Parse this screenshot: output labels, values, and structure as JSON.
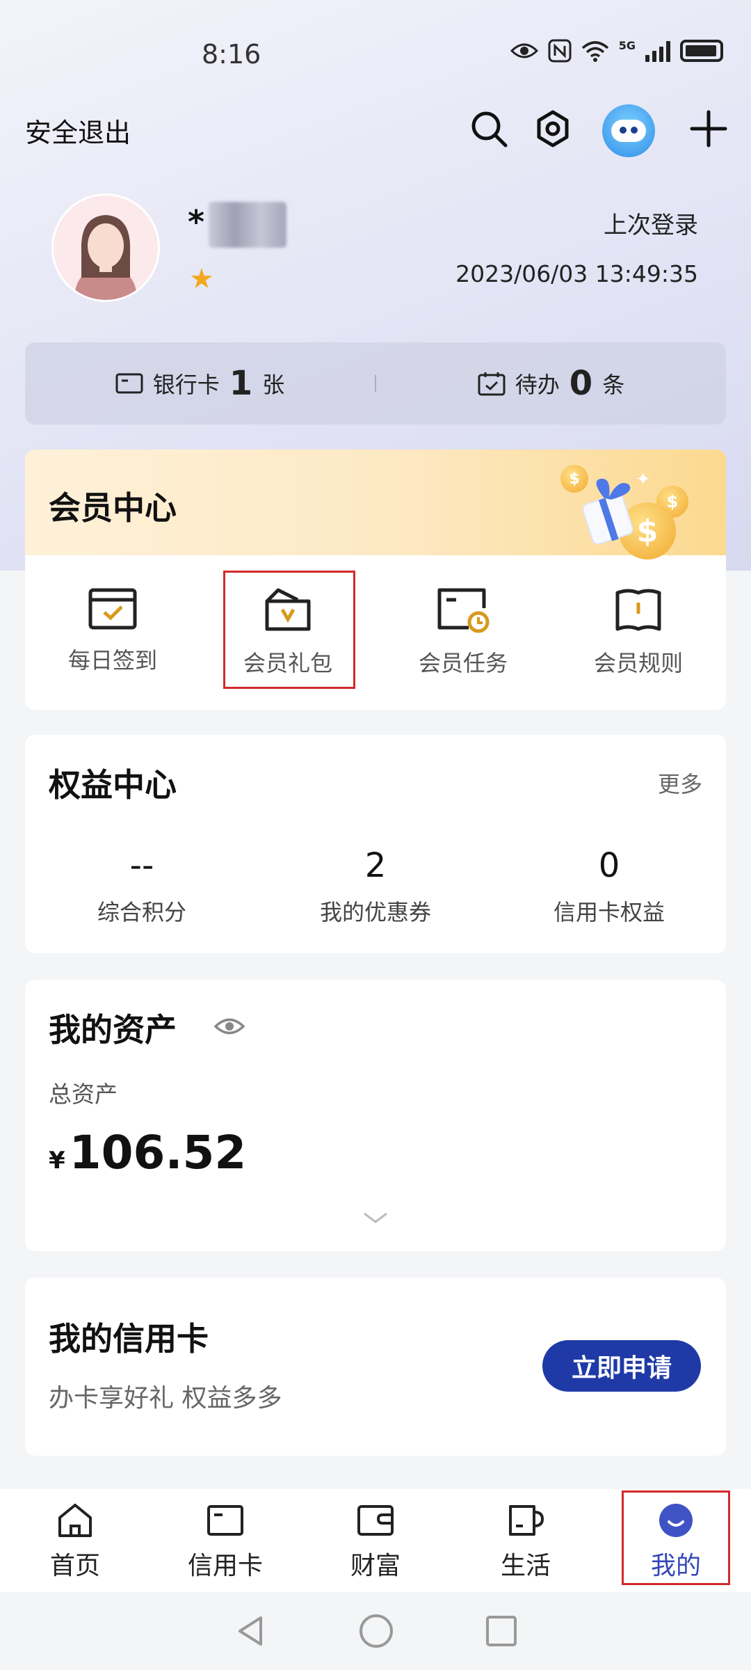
{
  "status_bar": {
    "time": "8:16",
    "network": "5G"
  },
  "header": {
    "logout_label": "安全退出"
  },
  "profile": {
    "name_prefix": "*",
    "last_login_label": "上次登录",
    "last_login_time": "2023/06/03 13:49:35"
  },
  "summary": {
    "bank_card_label": "银行卡",
    "bank_card_count": "1",
    "bank_card_unit": "张",
    "todo_label": "待办",
    "todo_count": "0",
    "todo_unit": "条"
  },
  "member_center": {
    "title": "会员中心",
    "items": [
      {
        "label": "每日签到",
        "icon": "calendar-check-icon"
      },
      {
        "label": "会员礼包",
        "icon": "gift-pack-icon"
      },
      {
        "label": "会员任务",
        "icon": "task-clock-icon"
      },
      {
        "label": "会员规则",
        "icon": "rules-book-icon"
      }
    ]
  },
  "benefits": {
    "title": "权益中心",
    "more_label": "更多",
    "stats": [
      {
        "value": "--",
        "label": "综合积分"
      },
      {
        "value": "2",
        "label": "我的优惠券"
      },
      {
        "value": "0",
        "label": "信用卡权益"
      }
    ]
  },
  "assets": {
    "title": "我的资产",
    "total_label": "总资产",
    "currency": "¥",
    "amount": "106.52"
  },
  "credit_card": {
    "title": "我的信用卡",
    "subtitle": "办卡享好礼 权益多多",
    "apply_label": "立即申请"
  },
  "tabs": [
    {
      "label": "首页",
      "icon": "home-icon"
    },
    {
      "label": "信用卡",
      "icon": "credit-card-icon"
    },
    {
      "label": "财富",
      "icon": "wallet-icon"
    },
    {
      "label": "生活",
      "icon": "cup-icon"
    },
    {
      "label": "我的",
      "icon": "profile-smile-icon",
      "active": true
    }
  ],
  "colors": {
    "accent": "#1f3aa6",
    "active_tab": "#3548b8",
    "highlight_box": "#d3292b",
    "star": "#f4a81d"
  }
}
